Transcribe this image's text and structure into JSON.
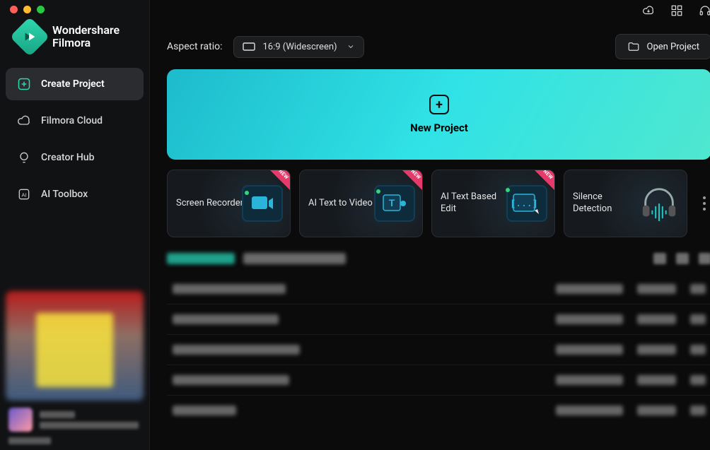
{
  "app": {
    "brand_line1": "Wondershare",
    "brand_line2": "Filmora"
  },
  "sidebar": {
    "items": [
      {
        "label": "Create Project",
        "icon": "plus-square-icon",
        "active": true
      },
      {
        "label": "Filmora Cloud",
        "icon": "cloud-icon",
        "active": false
      },
      {
        "label": "Creator Hub",
        "icon": "bulb-icon",
        "active": false
      },
      {
        "label": "AI Toolbox",
        "icon": "ai-icon",
        "active": false
      }
    ]
  },
  "header": {
    "aspect_label": "Aspect ratio:",
    "aspect_value": "16:9 (Widescreen)",
    "open_project": "Open Project"
  },
  "hero": {
    "new_project": "New Project"
  },
  "tools": [
    {
      "label": "Screen Recorder",
      "new": true,
      "illus": "recorder"
    },
    {
      "label": "AI Text to Video",
      "new": true,
      "illus": "text"
    },
    {
      "label": "AI Text Based Edit",
      "new": true,
      "illus": "edit"
    },
    {
      "label": "Silence Detection",
      "new": false,
      "illus": "silence"
    }
  ],
  "colors": {
    "accent_gradient_from": "#1dbbcc",
    "accent_gradient_to": "#4fe7cf",
    "brand": "#2dd8b0"
  }
}
